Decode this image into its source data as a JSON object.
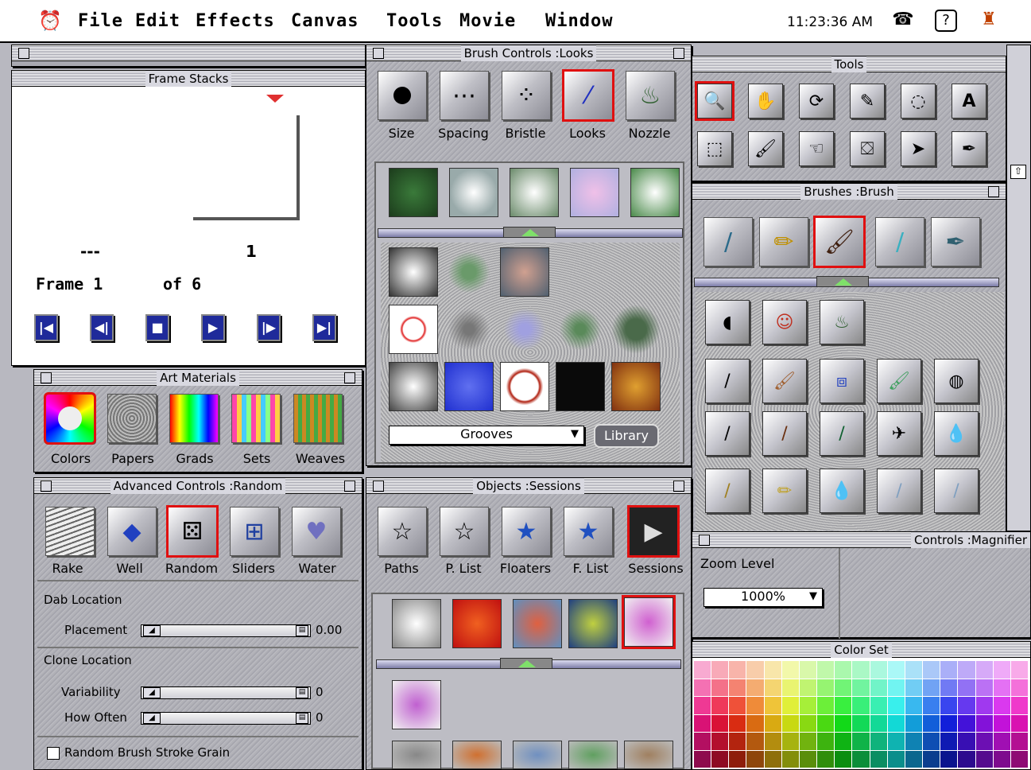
{
  "menubar": {
    "items": [
      "File",
      "Edit",
      "Effects",
      "Canvas",
      "Tools",
      "Movie",
      "Window"
    ],
    "clock": "11:23:36 AM",
    "icons": [
      "alarm-clock-icon",
      "telephone-icon",
      "help-icon",
      "painter-app-icon"
    ]
  },
  "frame_stacks": {
    "title": "Frame Stacks",
    "prev_frame": "---",
    "next_frame": "1",
    "frame_label": "Frame 1",
    "of_label": "of 6",
    "controls": [
      "rewind",
      "step-back",
      "stop",
      "play",
      "step-forward",
      "end"
    ]
  },
  "brush_controls": {
    "title": "Brush Controls :Looks",
    "tabs": [
      "Size",
      "Spacing",
      "Bristle",
      "Looks",
      "Nozzle"
    ],
    "selected": "Looks",
    "paper": "Grooves",
    "library_label": "Library"
  },
  "tools": {
    "title": "Tools"
  },
  "brushes": {
    "title": "Brushes :Brush"
  },
  "art_materials": {
    "title": "Art Materials",
    "tabs": [
      "Colors",
      "Papers",
      "Grads",
      "Sets",
      "Weaves"
    ],
    "selected": "Colors"
  },
  "advanced_controls": {
    "title": "Advanced Controls :Random",
    "tabs": [
      "Rake",
      "Well",
      "Random",
      "Sliders",
      "Water"
    ],
    "selected": "Random",
    "dab_location": "Dab Location",
    "placement_label": "Placement",
    "placement_value": "0.00",
    "clone_location": "Clone Location",
    "variability_label": "Variability",
    "variability_value": "0",
    "how_often_label": "How Often",
    "how_often_value": "0",
    "checkbox_label": "Random Brush Stroke Grain",
    "placement_fraction": 0,
    "variability_fraction": 0,
    "how_often_fraction": 0
  },
  "objects": {
    "title": "Objects :Sessions",
    "tabs": [
      "Paths",
      "P. List",
      "Floaters",
      "F. List",
      "Sessions"
    ],
    "selected": "Sessions"
  },
  "controls_magnifier": {
    "title": "Controls :Magnifier",
    "zoom_label": "Zoom Level",
    "zoom_value": "1000%"
  },
  "color_set": {
    "title": "Color Set"
  }
}
